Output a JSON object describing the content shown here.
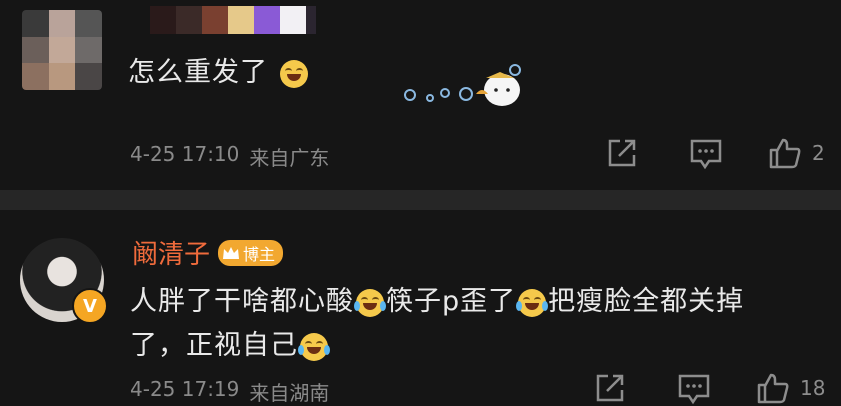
{
  "comments": [
    {
      "text": "怎么重发了",
      "time": "4-25 17:10",
      "location": "来自广东",
      "likes": "2"
    },
    {
      "author": "阚清子",
      "badge": "博主",
      "text_parts": [
        "人胖了干啥都心酸",
        "筷子p歪了",
        "把瘦脸全都关掉"
      ],
      "text_line2": "了，正视自己",
      "time": "4-25 17:19",
      "location": "来自湖南",
      "likes": "18",
      "avatar_verified": "V"
    }
  ],
  "icons": {
    "share": "share-icon",
    "comment": "comment-icon",
    "like": "thumbs-up-icon"
  },
  "colors": {
    "background": "#151515",
    "author_name": "#f06b3c",
    "badge": "#f2a830",
    "meta_text": "#8a8a8a"
  }
}
